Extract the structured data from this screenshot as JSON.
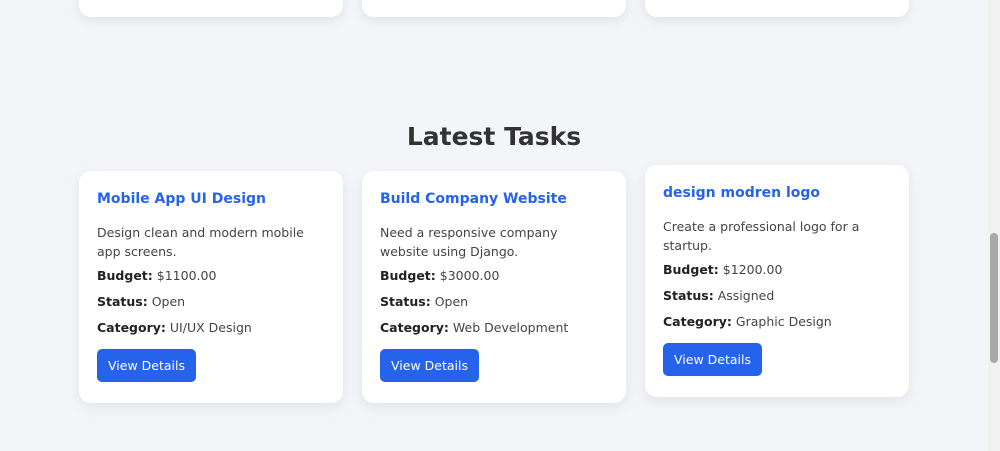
{
  "section": {
    "title": "Latest Tasks"
  },
  "tasks": [
    {
      "title": "Mobile App UI Design",
      "description": "Design clean and modern mobile app screens.",
      "budget_label": "Budget:",
      "budget": "$1100.00",
      "status_label": "Status:",
      "status": "Open",
      "category_label": "Category:",
      "category": "UI/UX Design",
      "button_label": "View Details"
    },
    {
      "title": "Build Company Website",
      "description": "Need a responsive company website using Django.",
      "budget_label": "Budget:",
      "budget": "$3000.00",
      "status_label": "Status:",
      "status": "Open",
      "category_label": "Category:",
      "category": "Web Development",
      "button_label": "View Details"
    },
    {
      "title": "design modren logo",
      "description": "Create a professional logo for a startup.",
      "budget_label": "Budget:",
      "budget": "$1200.00",
      "status_label": "Status:",
      "status": "Assigned",
      "category_label": "Category:",
      "category": "Graphic Design",
      "button_label": "View Details"
    }
  ],
  "colors": {
    "accent": "#2563eb",
    "background": "#f3f5f9",
    "card": "#ffffff",
    "heading": "#333333"
  }
}
